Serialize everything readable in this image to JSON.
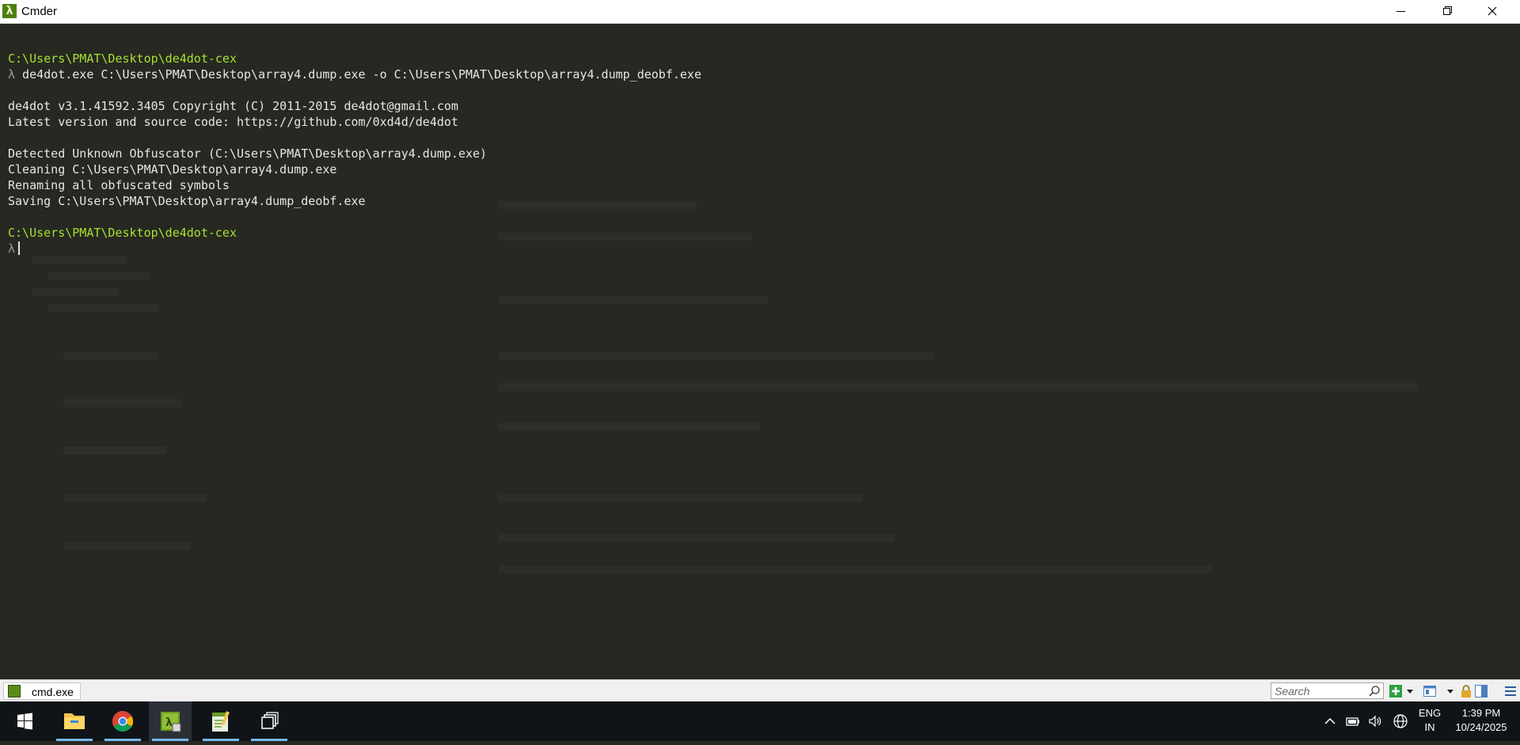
{
  "window": {
    "title": "Cmder",
    "icon": "lambda-icon",
    "controls": [
      "minimize-icon",
      "maximize-icon",
      "close-icon"
    ]
  },
  "terminal": {
    "lines": [
      {
        "kind": "path",
        "text": "C:\\Users\\PMAT\\Desktop\\de4dot-cex"
      },
      {
        "kind": "command",
        "prefix": "λ",
        "text": " de4dot.exe C:\\Users\\PMAT\\Desktop\\array4.dump.exe -o C:\\Users\\PMAT\\Desktop\\array4.dump_deobf.exe"
      },
      {
        "kind": "blank",
        "text": ""
      },
      {
        "kind": "output",
        "text": "de4dot v3.1.41592.3405 Copyright (C) 2011-2015 de4dot@gmail.com"
      },
      {
        "kind": "output",
        "text": "Latest version and source code: https://github.com/0xd4d/de4dot"
      },
      {
        "kind": "blank",
        "text": ""
      },
      {
        "kind": "output",
        "text": "Detected Unknown Obfuscator (C:\\Users\\PMAT\\Desktop\\array4.dump.exe)"
      },
      {
        "kind": "output",
        "text": "Cleaning C:\\Users\\PMAT\\Desktop\\array4.dump.exe"
      },
      {
        "kind": "output",
        "text": "Renaming all obfuscated symbols"
      },
      {
        "kind": "output",
        "text": "Saving C:\\Users\\PMAT\\Desktop\\array4.dump_deobf.exe"
      },
      {
        "kind": "blank",
        "text": ""
      },
      {
        "kind": "path",
        "text": "C:\\Users\\PMAT\\Desktop\\de4dot-cex"
      },
      {
        "kind": "prompt",
        "prefix": "λ",
        "text": ""
      }
    ]
  },
  "statusbar": {
    "tab_label": "cmd.exe",
    "search_placeholder": "Search",
    "icons": [
      "new-console-icon",
      "dropdown-icon",
      "layout-icon",
      "lock-icon",
      "split-icon",
      "menu-icon"
    ]
  },
  "taskbar": {
    "apps": [
      "windows-start-icon",
      "file-explorer-icon",
      "chrome-icon",
      "cmder-icon",
      "notepad-icon",
      "task-view-icon"
    ],
    "language": "ENG",
    "region": "IN",
    "time": "1:39 PM",
    "date": "10/24/2025"
  },
  "colors": {
    "terminal_bg": "#272822",
    "path_color": "#a6e22e",
    "text_color": "#e6e6e6",
    "taskbar_bg": "#101418"
  }
}
